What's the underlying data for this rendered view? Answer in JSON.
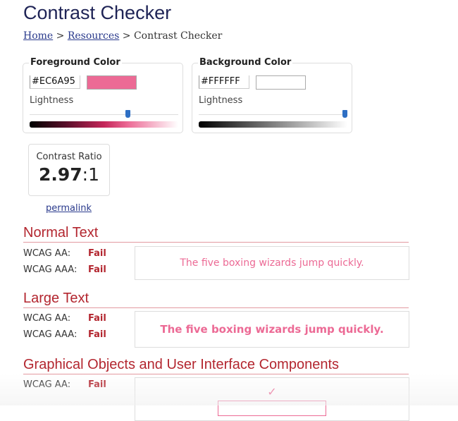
{
  "page": {
    "title": "Contrast Checker"
  },
  "breadcrumb": {
    "items": [
      "Home",
      "Resources"
    ],
    "separator": ">",
    "current": "Contrast Checker"
  },
  "foreground": {
    "legend": "Foreground Color",
    "hex": "#EC6A95",
    "swatch_color": "#EC6A95",
    "lightness_label": "Lightness",
    "lightness_value": 0.66
  },
  "background": {
    "legend": "Background Color",
    "hex": "#FFFFFF",
    "swatch_color": "#FFFFFF",
    "lightness_label": "Lightness",
    "lightness_value": 1.0
  },
  "contrast": {
    "label": "Contrast Ratio",
    "value": "2.97",
    "suffix": ":1",
    "permalink": "permalink"
  },
  "sections": {
    "normal": {
      "heading": "Normal Text",
      "aa_label": "WCAG AA:",
      "aa_result": "Fail",
      "aaa_label": "WCAG AAA:",
      "aaa_result": "Fail",
      "sample": "The five boxing wizards jump quickly."
    },
    "large": {
      "heading": "Large Text",
      "aa_label": "WCAG AA:",
      "aa_result": "Fail",
      "aaa_label": "WCAG AAA:",
      "aaa_result": "Fail",
      "sample": "The five boxing wizards jump quickly."
    },
    "graphical": {
      "heading": "Graphical Objects and User Interface Components",
      "aa_label": "WCAG AA:",
      "aa_result": "Fail",
      "check_icon": "✓"
    }
  },
  "colors": {
    "accent_fail": "#b3262f",
    "foreground": "#EC6A95",
    "title": "#1f2456"
  }
}
